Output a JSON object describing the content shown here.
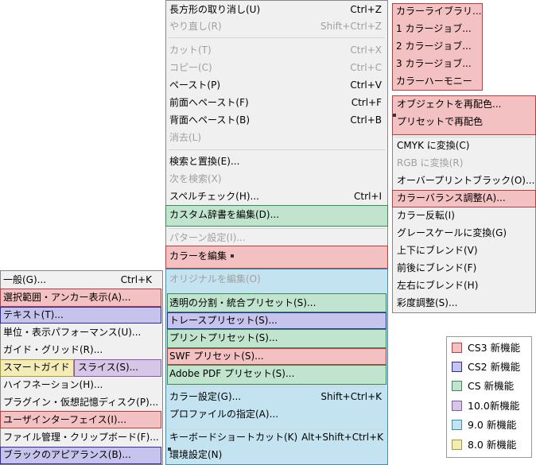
{
  "edit_menu": {
    "undo": {
      "label": "長方形の取り消し(U)",
      "shortcut": "Ctrl+Z"
    },
    "redo": {
      "label": "やり直し(R)",
      "shortcut": "Shift+Ctrl+Z"
    },
    "cut": {
      "label": "カット(T)",
      "shortcut": "Ctrl+X"
    },
    "copy": {
      "label": "コピー(C)",
      "shortcut": "Ctrl+C"
    },
    "paste": {
      "label": "ペースト(P)",
      "shortcut": "Ctrl+V"
    },
    "paste_front": {
      "label": "前面へペースト(F)",
      "shortcut": "Ctrl+F"
    },
    "paste_back": {
      "label": "背面へペースト(B)",
      "shortcut": "Ctrl+B"
    },
    "clear": {
      "label": "消去(L)"
    },
    "find_replace": {
      "label": "検索と置換(E)..."
    },
    "find_next": {
      "label": "次を検索(X)"
    },
    "spell_check": {
      "label": "スペルチェック(H)...",
      "shortcut": "Ctrl+I"
    },
    "custom_dict": {
      "label": "カスタム辞書を編集(D)..."
    },
    "pattern_settings": {
      "label": "パターン設定(I)..."
    },
    "edit_colors": {
      "label": "カラーを編集"
    },
    "edit_original": {
      "label": "オリジナルを編集(O)"
    },
    "flatten_presets": {
      "label": "透明の分割・統合プリセット(S)..."
    },
    "trace_presets": {
      "label": "トレースプリセット(S)..."
    },
    "print_presets": {
      "label": "プリントプリセット(S)..."
    },
    "swf_presets": {
      "label": "SWF プリセット(S)..."
    },
    "pdf_presets": {
      "label": "Adobe PDF プリセット(S)..."
    },
    "color_settings": {
      "label": "カラー設定(G)...",
      "shortcut": "Shift+Ctrl+K"
    },
    "assign_profile": {
      "label": "プロファイルの指定(A)..."
    },
    "keyboard_shortcuts": {
      "label": "キーボードショートカット(K)",
      "shortcut": "Alt+Shift+Ctrl+K"
    },
    "preferences": {
      "label": "環境設定(N)"
    }
  },
  "color_library_menu": {
    "items": [
      "カラーライブラリ...",
      "1 カラージョブ...",
      "2 カラージョブ...",
      "3 カラージョブ...",
      "カラーハーモニー"
    ]
  },
  "edit_colors_submenu": {
    "recolor_artwork": "オブジェクトを再配色...",
    "recolor_preset": "プリセットで再配色",
    "convert_cmyk": "CMYK に変換(C)",
    "convert_rgb": "RGB に変換(R)",
    "overprint_black": "オーバープリントブラック(O)...",
    "adjust_balance": "カラーバランス調整(A)...",
    "invert": "カラー反転(I)",
    "grayscale": "グレースケールに変換(G)",
    "blend_vertical": "上下にブレンド(V)",
    "blend_front_back": "前後にブレンド(F)",
    "blend_horizontal": "左右にブレンド(H)",
    "saturate": "彩度調整(S)..."
  },
  "preferences_submenu": {
    "general": {
      "label": "一般(G)...",
      "shortcut": "Ctrl+K"
    },
    "selection": "選択範囲・アンカー表示(A)...",
    "type": "テキスト(T)...",
    "units": "単位・表示パフォーマンス(U)...",
    "guides": "ガイド・グリッド(R)...",
    "smart_guides": "スマートガイド",
    "slices": "スライス(S)...",
    "hyphenation": "ハイフネーション(H)...",
    "plugins": "プラグイン・仮想記憶ディスク(P)...",
    "ui": "ユーザインターフェイス(I)...",
    "file_handling": "ファイル管理・クリップボード(F)...",
    "black_appearance": "ブラックのアピアランス(B)..."
  },
  "legend": [
    {
      "label": "CS3 新機能",
      "color": "#f3c1c1",
      "border": "#c23b3b"
    },
    {
      "label": "CS2 新機能",
      "color": "#c6c3ec",
      "border": "#2b2ba6"
    },
    {
      "label": "CS 新機能",
      "color": "#c0e4cd",
      "border": "#3a8a58"
    },
    {
      "label": "10.0新機能",
      "color": "#d7c6e6",
      "border": "#8655ad"
    },
    {
      "label": "9.0 新機能",
      "color": "#c4e3f1",
      "border": "#3a8fae"
    },
    {
      "label": "8.0 新機能",
      "color": "#f3ecb8",
      "border": "#a89a32"
    }
  ]
}
